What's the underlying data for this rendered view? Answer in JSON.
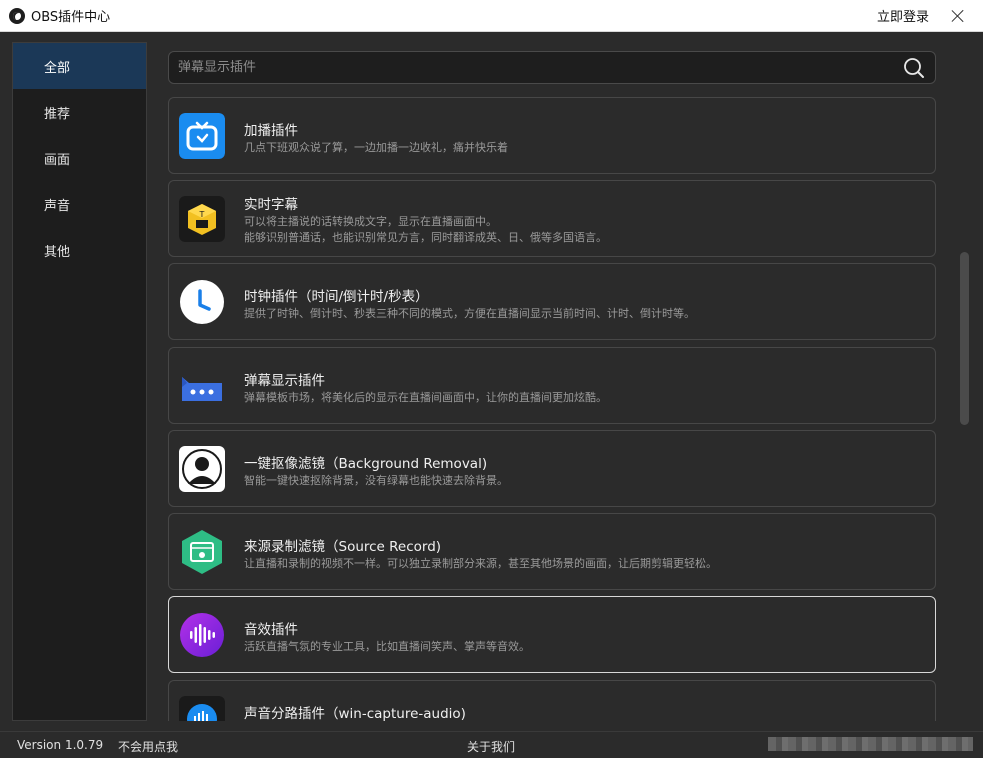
{
  "window": {
    "title": "OBS插件中心",
    "login_label": "立即登录"
  },
  "sidebar": {
    "items": [
      {
        "label": "全部",
        "active": true
      },
      {
        "label": "推荐",
        "active": false
      },
      {
        "label": "画面",
        "active": false
      },
      {
        "label": "声音",
        "active": false
      },
      {
        "label": "其他",
        "active": false
      }
    ]
  },
  "search": {
    "placeholder": "弹幕显示插件"
  },
  "plugins": [
    {
      "name": "加播插件",
      "desc": [
        "几点下班观众说了算，一边加播一边收礼，痛并快乐着"
      ],
      "icon": "gift-tv-icon"
    },
    {
      "name": "实时字幕",
      "desc": [
        "可以将主播说的话转换成文字，显示在直播画面中。",
        "能够识别普通话，也能识别常见方言，同时翻译成英、日、俄等多国语言。"
      ],
      "icon": "subtitle-box-icon"
    },
    {
      "name": "时钟插件（时间/倒计时/秒表）",
      "desc": [
        "提供了时钟、倒计时、秒表三种不同的模式，方便在直播间显示当前时间、计时、倒计时等。"
      ],
      "icon": "clock-icon"
    },
    {
      "name": "弹幕显示插件",
      "desc": [
        "弹幕模板市场，将美化后的显示在直播间画面中，让你的直播间更加炫酷。"
      ],
      "icon": "chat-bubble-icon"
    },
    {
      "name": "一键抠像滤镜（Background Removal)",
      "desc": [
        "智能一键快速抠除背景，没有绿幕也能快速去除背景。"
      ],
      "icon": "person-icon"
    },
    {
      "name": "来源录制滤镜（Source Record)",
      "desc": [
        "让直播和录制的视频不一样。可以独立录制部分来源，甚至其他场景的画面，让后期剪辑更轻松。"
      ],
      "icon": "record-hexagon-icon"
    },
    {
      "name": "音效插件",
      "desc": [
        "活跃直播气氛的专业工具，比如直播间笑声、掌声等音效。"
      ],
      "icon": "sound-wave-icon"
    },
    {
      "name": "声音分路插件（win-capture-audio)",
      "desc": [
        ""
      ],
      "icon": "audio-split-icon"
    }
  ],
  "footer": {
    "version": "Version 1.0.79",
    "not_use": "不会用点我",
    "about": "关于我们"
  },
  "colors": {
    "accent_nav": "#1b3857",
    "background": "#2b2b2b",
    "card_border": "#474747"
  }
}
